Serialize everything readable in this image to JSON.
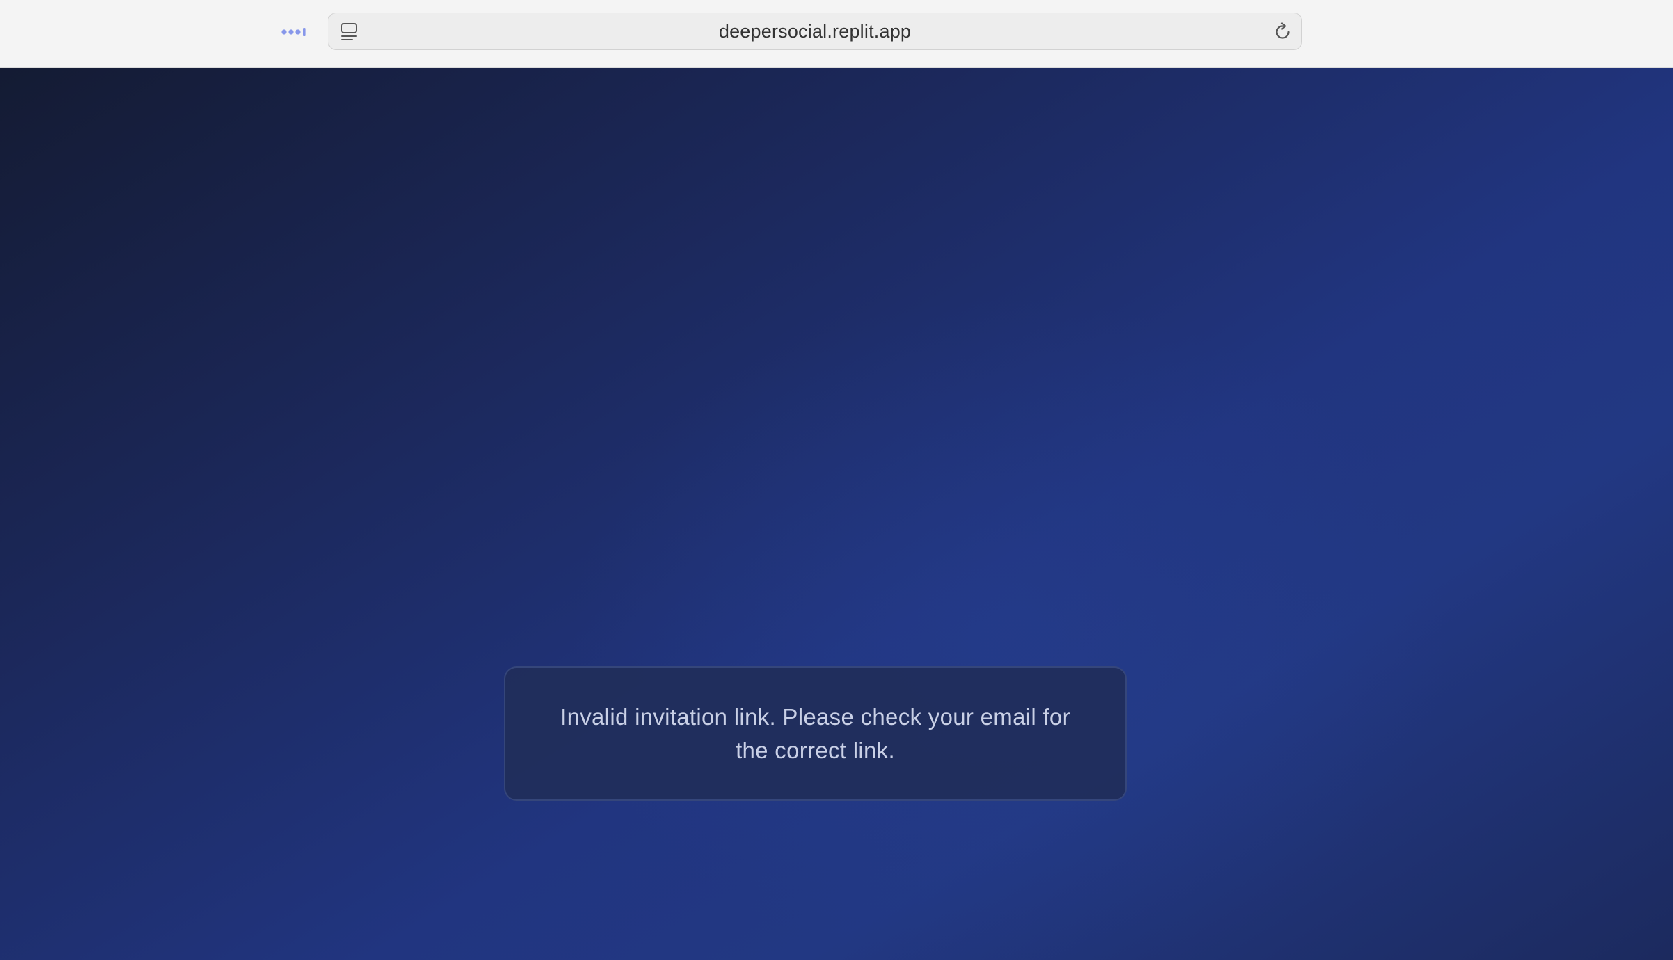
{
  "browser": {
    "url": "deepersocial.replit.app",
    "icons": {
      "menu": "dots-icon",
      "sidebar": "sidebar-icon",
      "reload": "reload-icon"
    },
    "colors": {
      "bar_background": "#f4f4f4",
      "accent_dots": "#7c8ff0"
    }
  },
  "page": {
    "message": "Invalid invitation link. Please check your email for the correct link.",
    "colors": {
      "background_dark": "#141b33",
      "background_mid": "#213580",
      "card_background": "#212e5a",
      "text": "#c9d0e6"
    }
  }
}
